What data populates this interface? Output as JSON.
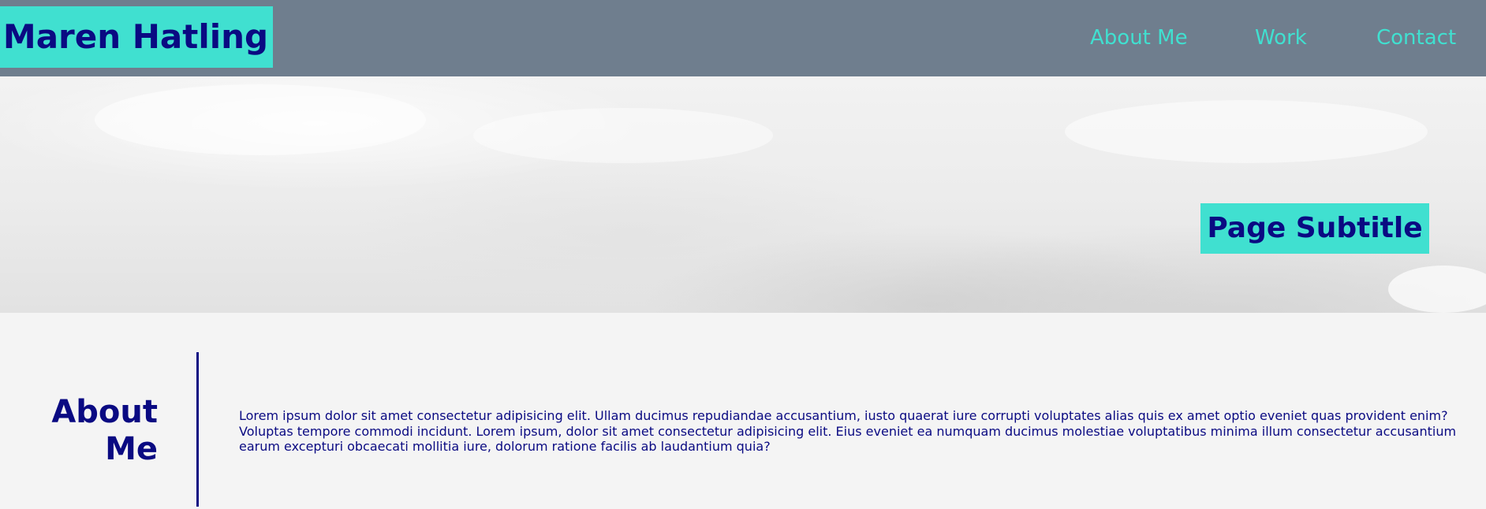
{
  "header": {
    "logo_text": "Maren Hatling",
    "nav": [
      {
        "label": "About Me"
      },
      {
        "label": "Work"
      },
      {
        "label": "Contact"
      }
    ]
  },
  "hero": {
    "subtitle": "Page Subtitle"
  },
  "about": {
    "heading": "About Me",
    "body": "Lorem ipsum dolor sit amet consectetur adipisicing elit. Ullam ducimus repudiandae accusantium, iusto quaerat iure corrupti voluptates alias quis ex amet optio eveniet quas provident enim? Voluptas tempore commodi incidunt. Lorem ipsum, dolor sit amet consectetur adipisicing elit. Eius eveniet ea numquam ducimus molestiae voluptatibus minima illum consectetur accusantium earum excepturi obcaecati mollitia iure, dolorum ratione facilis ab laudantium quia?"
  },
  "colors": {
    "header_bg": "#6f7e8e",
    "accent": "#40e0d0",
    "text_dark": "#0a0a82",
    "page_bg": "#f4f4f4"
  }
}
